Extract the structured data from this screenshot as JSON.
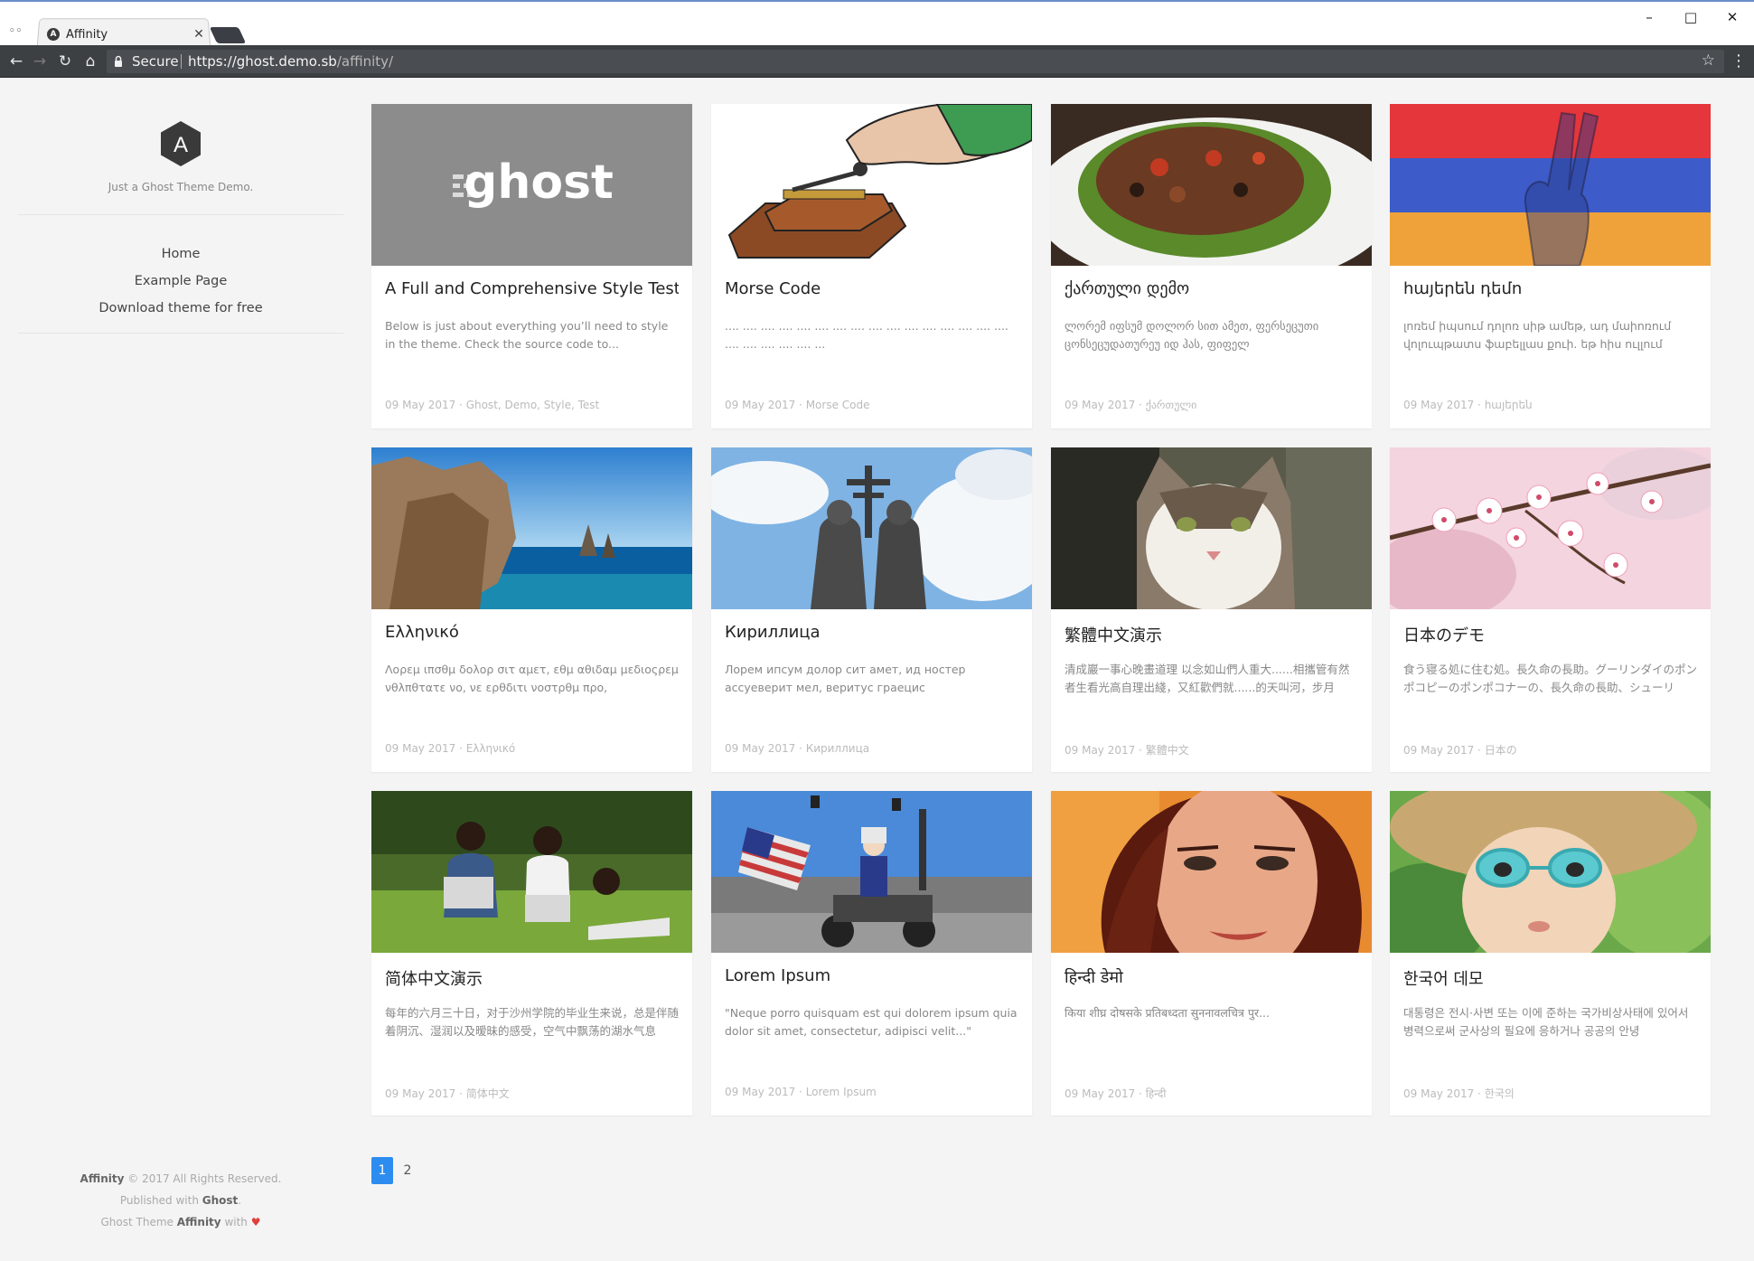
{
  "browser": {
    "tab_title": "Affinity",
    "tab_favicon": "A",
    "secure_label": "Secure",
    "url_host": "https://ghost.demo.sb",
    "url_path": "/affinity/",
    "icons": [
      "profile-icon",
      "back-icon",
      "forward-icon",
      "reload-icon",
      "home-icon",
      "lock-icon",
      "star-icon",
      "menu-icon",
      "minimize-icon",
      "maximize-icon",
      "close-icon"
    ]
  },
  "sidebar": {
    "logo_letter": "A",
    "tagline": "Just a Ghost Theme Demo.",
    "nav": [
      {
        "label": "Home"
      },
      {
        "label": "Example Page"
      },
      {
        "label": "Download theme for free"
      }
    ]
  },
  "footer": {
    "brand": "Affinity",
    "rights": "© 2017 All Rights Reserved.",
    "published_prefix": "Published with",
    "published_brand": "Ghost",
    "theme_prefix": "Ghost Theme",
    "theme_brand": "Affinity",
    "theme_suffix": "with"
  },
  "posts": [
    {
      "title": "A Full and Comprehensive Style Test",
      "excerpt": "Below is just about everything you’ll need to style in the theme. Check the source code to...",
      "meta": "09 May 2017 · Ghost, Demo, Style, Test",
      "image": "ghost-logo"
    },
    {
      "title": "Morse Code",
      "excerpt": ".... .... .... .... .... .... .... .... .... .... .... .... .... .... .... .... .... .... .... .... .... ...",
      "meta": "09 May 2017 · Morse Code",
      "image": "telegraph-key"
    },
    {
      "title": "ქართული დემო",
      "excerpt": "ლორემ იფსუმ დოლორ სით ამეთ, ფერსეცუთი ცონსეცუდათურეუ იდ ჰას, ფიფელ",
      "meta": "09 May 2017 · ქართული",
      "image": "food-plate"
    },
    {
      "title": "հայերեն դեմո",
      "excerpt": "լոռեմ իպսում դոլոռ սիթ ամեթ, ադ մաիոռում վոլուպթատս ֆաբելլաս քուի. եթ հիս ուլլում",
      "meta": "09 May 2017 · հայերեն",
      "image": "armenian-flag-hand"
    },
    {
      "title": "Ελληνικό",
      "excerpt": "Λορεμ ιπσθμ δολορ σιτ αμετ, εθμ αθιδαμ μεδιοςρεμ νθλπθτατε νο, νε ερθδιτι νοστρθμ προ,",
      "meta": "09 May 2017 · Ελληνικό",
      "image": "sea-cliffs"
    },
    {
      "title": "Кириллица",
      "excerpt": "Лорем ипсум долор сит амет, ид ностер ассуеверит мел, веритус граецис медиоцритатем",
      "meta": "09 May 2017 · Кириллица",
      "image": "statue"
    },
    {
      "title": "繁體中文演示",
      "excerpt": "清成巖一事心晚畫道理 以念如山們人重大......相攜管有然者生看光高自理出綫，又紅歡們就......的天叫河，步月",
      "meta": "09 May 2017 · 繁體中文",
      "image": "cat"
    },
    {
      "title": "日本のデモ",
      "excerpt": "食う寝る処に住む処。長久命の長助。グーリンダイのポンポコピーのポンポコナーの、長久命の長助、シューリ",
      "meta": "09 May 2017 · 日本の",
      "image": "cherry-blossom"
    },
    {
      "title": "简体中文演示",
      "excerpt": "每年的六月三十日，对于沙州学院的毕业生来说，总是伴随着阴沉、湿润以及暧昧的感受，空气中飘荡的湖水气息",
      "meta": "09 May 2017 · 简体中文",
      "image": "students-laptops"
    },
    {
      "title": "Lorem Ipsum",
      "excerpt": "\"Neque porro quisquam est qui dolorem ipsum quia dolor sit amet, consectetur, adipisci velit...\"",
      "meta": "09 May 2017 · Lorem Ipsum",
      "image": "parade-motorcycle"
    },
    {
      "title": "हिन्दी डेमो",
      "excerpt": "किया शीघ्र दोषसके प्रतिबध्दता सुननावलचित्र पुर...",
      "meta": "09 May 2017 · हिन्दी",
      "image": "woman-portrait"
    },
    {
      "title": "한국어 데모",
      "excerpt": "대통령은 전시·사변 또는 이에 준하는 국가비상사태에 있어서 병력으로써 군사상의 필요에 응하거나 공공의 안녕",
      "meta": "09 May 2017 · 한국의",
      "image": "child-sunglasses"
    }
  ],
  "pagination": {
    "pages": [
      "1",
      "2"
    ],
    "current": "1"
  },
  "colors": {
    "accent": "#2d8cf0",
    "chrome_dark": "#3c4043",
    "heart": "#e0403a"
  }
}
